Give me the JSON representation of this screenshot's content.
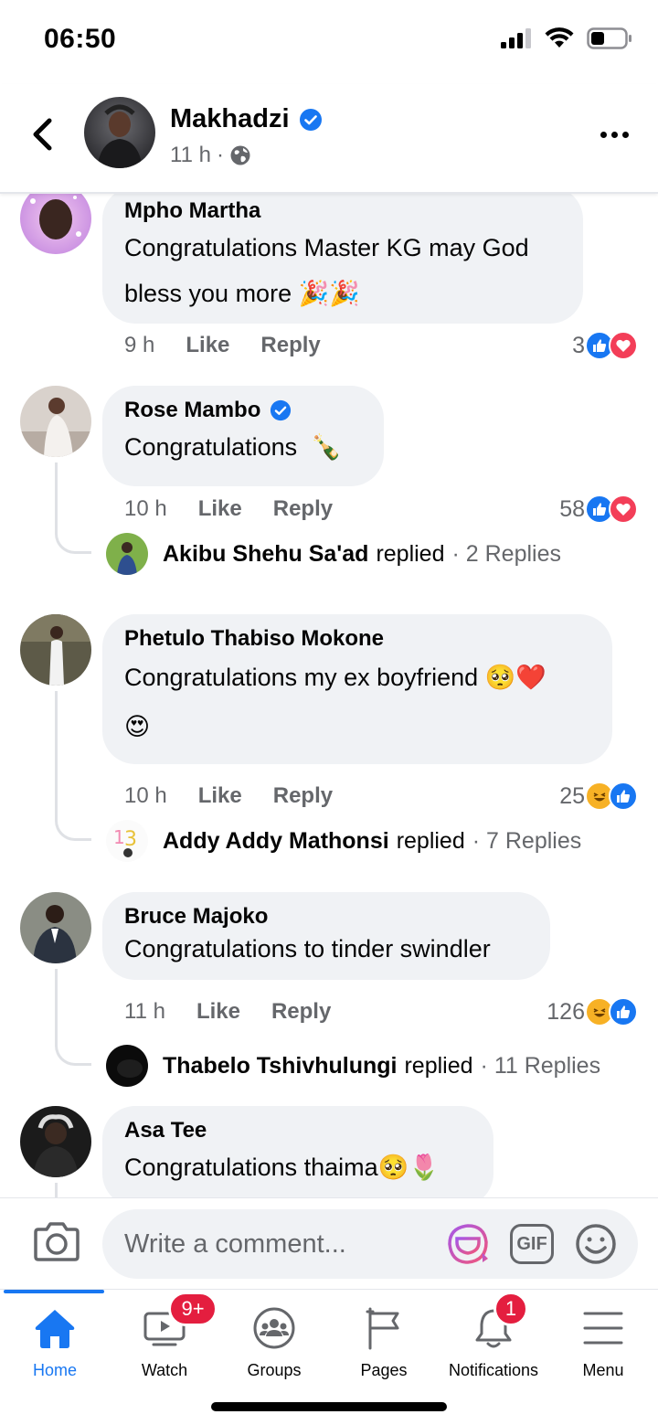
{
  "status_bar": {
    "time": "06:50"
  },
  "header": {
    "name": "Makhadzi",
    "time": "11 h",
    "separator": "·",
    "audience_icon": "globe-icon"
  },
  "comments": [
    {
      "author": "Mpho Martha",
      "verified": false,
      "text_line1": "Congratulations Master KG may God",
      "text_line2": "bless you more",
      "emoji": "🎉🎉",
      "time": "9 h",
      "like": "Like",
      "reply": "Reply",
      "reaction_count": "3",
      "reactions": [
        "like",
        "love"
      ]
    },
    {
      "author": "Rose Mambo",
      "verified": true,
      "text": "Congratulations",
      "emoji": "🍾",
      "time": "10 h",
      "like": "Like",
      "reply": "Reply",
      "reaction_count": "58",
      "reactions": [
        "like",
        "love"
      ],
      "reply_summary": {
        "name": "Akibu Shehu Sa'ad",
        "verb": "replied",
        "count": "· 2 Replies"
      }
    },
    {
      "author": "Phetulo Thabiso Mokone",
      "verified": false,
      "text": "Congratulations my ex boyfriend",
      "emoji": "🥺❤️",
      "emoji_line2": "😍",
      "time": "10 h",
      "like": "Like",
      "reply": "Reply",
      "reaction_count": "25",
      "reactions": [
        "haha",
        "like"
      ],
      "reply_summary": {
        "name": "Addy Addy Mathonsi",
        "verb": "replied",
        "count": "· 7 Replies"
      }
    },
    {
      "author": "Bruce Majoko",
      "verified": false,
      "text": "Congratulations to tinder swindler",
      "time": "11 h",
      "like": "Like",
      "reply": "Reply",
      "reaction_count": "126",
      "reactions": [
        "haha",
        "like"
      ],
      "reply_summary": {
        "name": "Thabelo Tshivhulungi",
        "verb": "replied",
        "count": "· 11 Replies"
      }
    },
    {
      "author": "Asa Tee",
      "verified": false,
      "text": "Congratulations thaima",
      "emoji": "🥺🌷"
    }
  ],
  "composer": {
    "placeholder": "Write a comment...",
    "gif_label": "GIF"
  },
  "tabbar": {
    "items": [
      {
        "label": "Home",
        "icon": "home-icon",
        "active": true
      },
      {
        "label": "Watch",
        "icon": "watch-icon",
        "badge": "9+"
      },
      {
        "label": "Groups",
        "icon": "groups-icon"
      },
      {
        "label": "Pages",
        "icon": "flag-icon"
      },
      {
        "label": "Notifications",
        "icon": "bell-icon",
        "badge": "1"
      },
      {
        "label": "Menu",
        "icon": "hamburger-icon"
      }
    ]
  },
  "colors": {
    "brand": "#1877f2",
    "bubble": "#f0f2f5",
    "muted": "#65676b",
    "badge": "#e41e3f",
    "love": "#f33e58",
    "haha": "#f7b125"
  }
}
